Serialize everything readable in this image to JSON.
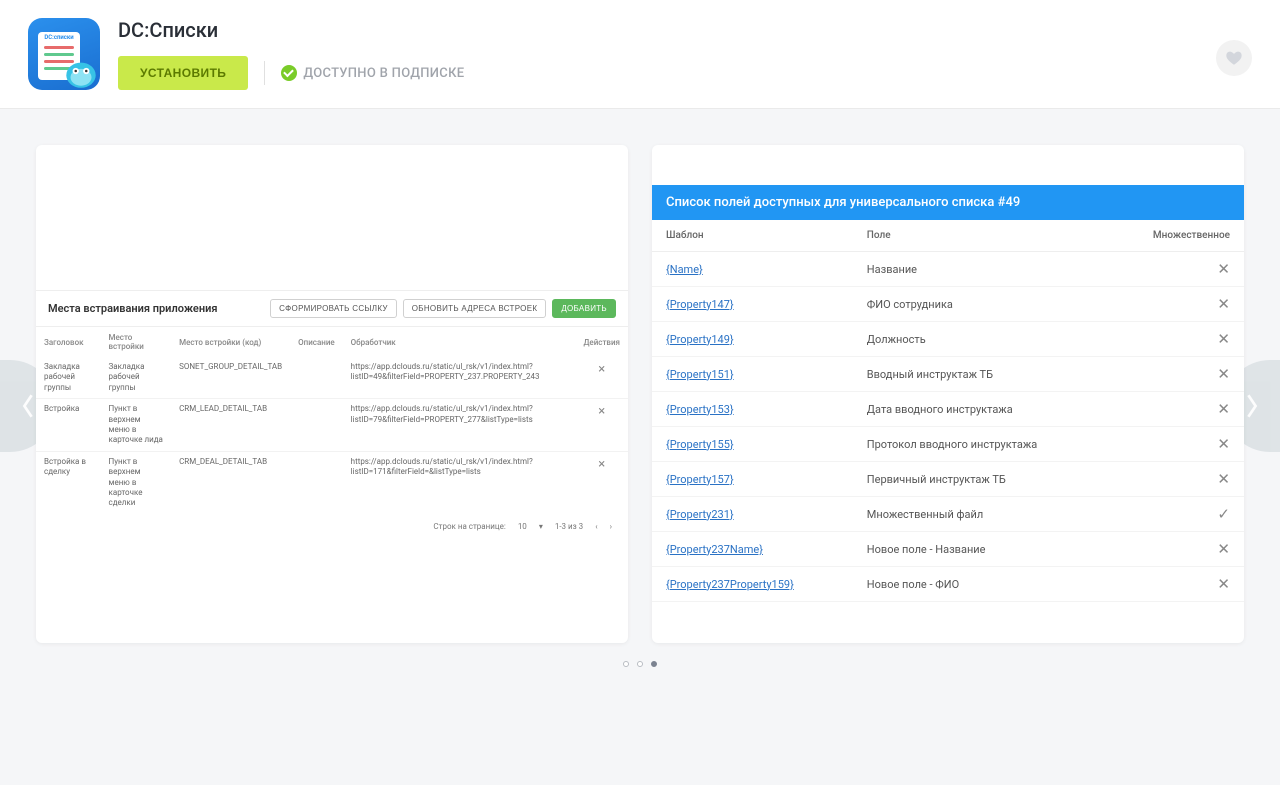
{
  "header": {
    "app_name": "DC:Списки",
    "icon_text": "DC:списки",
    "install": "УСТАНОВИТЬ",
    "sub_badge": "ДОСТУПНО В ПОДПИСКЕ"
  },
  "slide1": {
    "section_title": "Места встраивания приложения",
    "btn_form": "СФОРМИРОВАТЬ ССЫЛКУ",
    "btn_refresh": "ОБНОВИТЬ АДРЕСА ВСТРОЕК",
    "btn_add": "ДОБАВИТЬ",
    "cols": [
      "Заголовок",
      "Место встройки",
      "Место встройки (код)",
      "Описание",
      "Обработчик",
      "Действия"
    ],
    "rows": [
      {
        "t": "Закладка рабочей группы",
        "p": "Закладка рабочей группы",
        "c": "SONET_GROUP_DETAIL_TAB",
        "h": "https://app.dclouds.ru/static/ul_rsk/v1/index.html?listID=49&filterField=PROPERTY_237.PROPERTY_243"
      },
      {
        "t": "Встройка",
        "p": "Пункт в верхнем меню в карточке лида",
        "c": "CRM_LEAD_DETAIL_TAB",
        "h": "https://app.dclouds.ru/static/ul_rsk/v1/index.html?listID=79&filterField=PROPERTY_277&listType=lists"
      },
      {
        "t": "Встройка в сделку",
        "p": "Пункт в верхнем меню в карточке сделки",
        "c": "CRM_DEAL_DETAIL_TAB",
        "h": "https://app.dclouds.ru/static/ul_rsk/v1/index.html?listID=171&filterField=&listType=lists"
      }
    ],
    "pager_label": "Строк на странице:",
    "pager_size": "10",
    "pager_range": "1-3 из 3"
  },
  "slide2": {
    "title": "Список полей доступных для универсального списка #49",
    "cols": {
      "tpl": "Шаблон",
      "field": "Поле",
      "mult": "Множественное"
    },
    "rows": [
      {
        "tpl": "{Name}",
        "field": "Название",
        "mult": false
      },
      {
        "tpl": "{Property147}",
        "field": "ФИО сотрудника",
        "mult": false
      },
      {
        "tpl": "{Property149}",
        "field": "Должность",
        "mult": false
      },
      {
        "tpl": "{Property151}",
        "field": "Вводный инструктаж ТБ",
        "mult": false
      },
      {
        "tpl": "{Property153}",
        "field": "Дата вводного инструктажа",
        "mult": false
      },
      {
        "tpl": "{Property155}",
        "field": "Протокол вводного инструктажа",
        "mult": false
      },
      {
        "tpl": "{Property157}",
        "field": "Первичный инструктаж ТБ",
        "mult": false
      },
      {
        "tpl": "{Property231}",
        "field": "Множественный файл",
        "mult": true
      },
      {
        "tpl": "{Property237Name}",
        "field": "Новое поле - Название",
        "mult": false
      },
      {
        "tpl": "{Property237Property159}",
        "field": "Новое поле - ФИО",
        "mult": false
      }
    ]
  },
  "carousel": {
    "active": 2,
    "total": 3
  }
}
